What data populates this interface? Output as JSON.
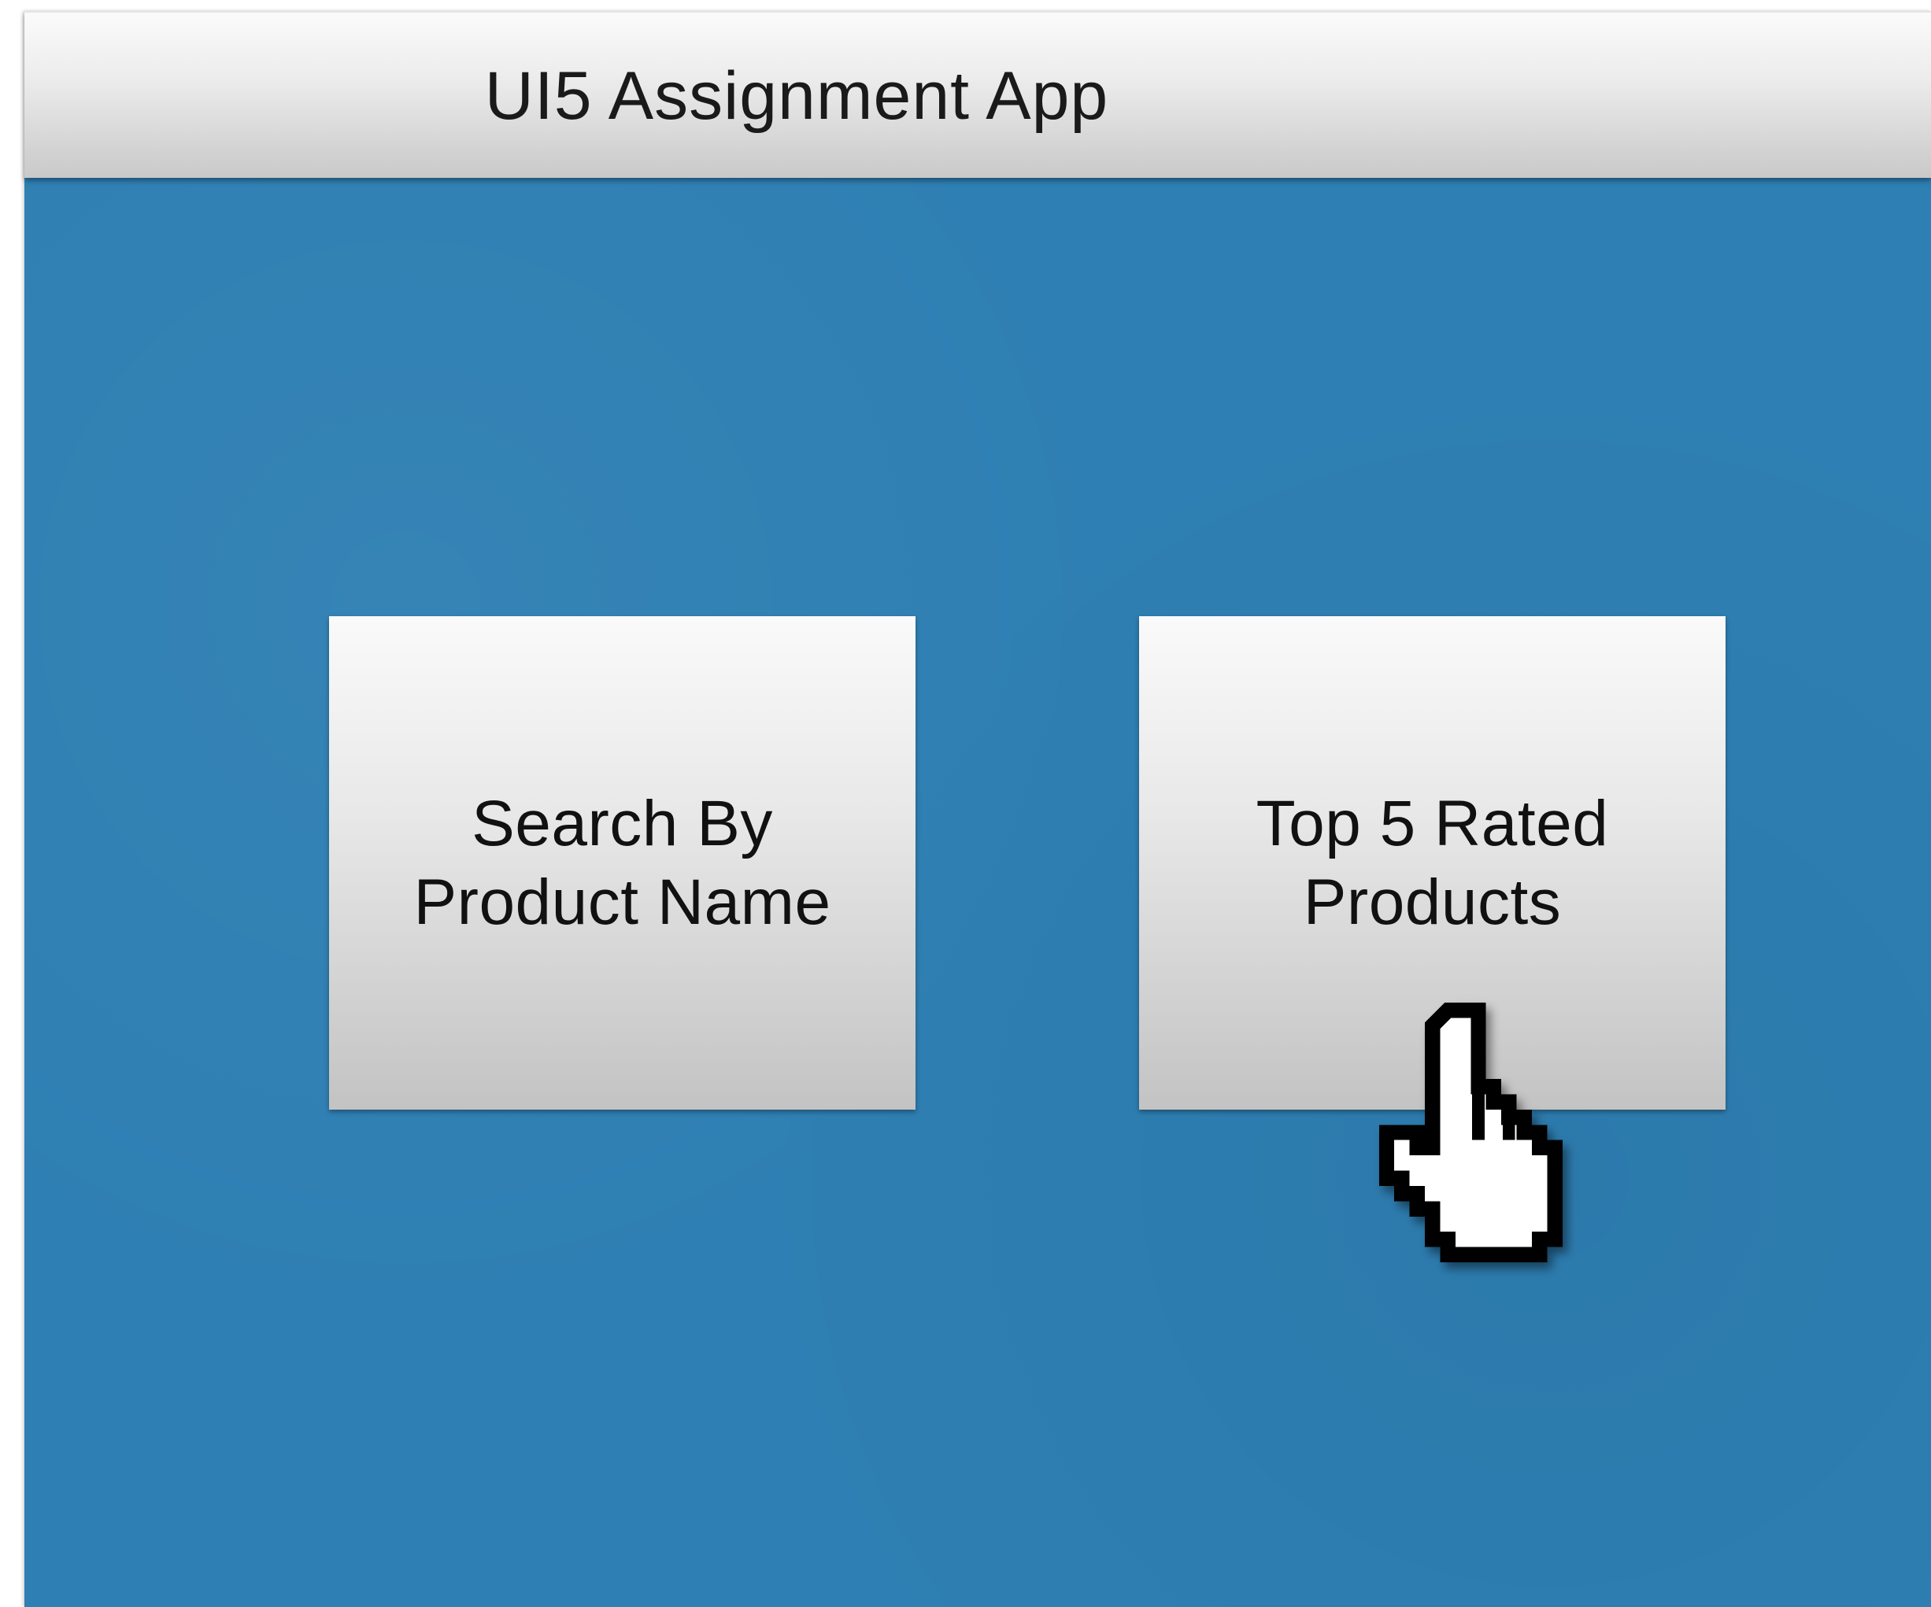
{
  "window": {
    "title": "UI5 Assignment App"
  },
  "tiles": [
    {
      "label": "Search By\nProduct Name"
    },
    {
      "label": "Top 5 Rated\nProducts"
    }
  ],
  "cursor": {
    "icon": "pointing-hand-cursor-icon"
  },
  "colors": {
    "background": "#2e7fb3",
    "title_bar": "#e6e6e6",
    "tile": "#dcdcdc",
    "text": "#1a1a1a"
  }
}
